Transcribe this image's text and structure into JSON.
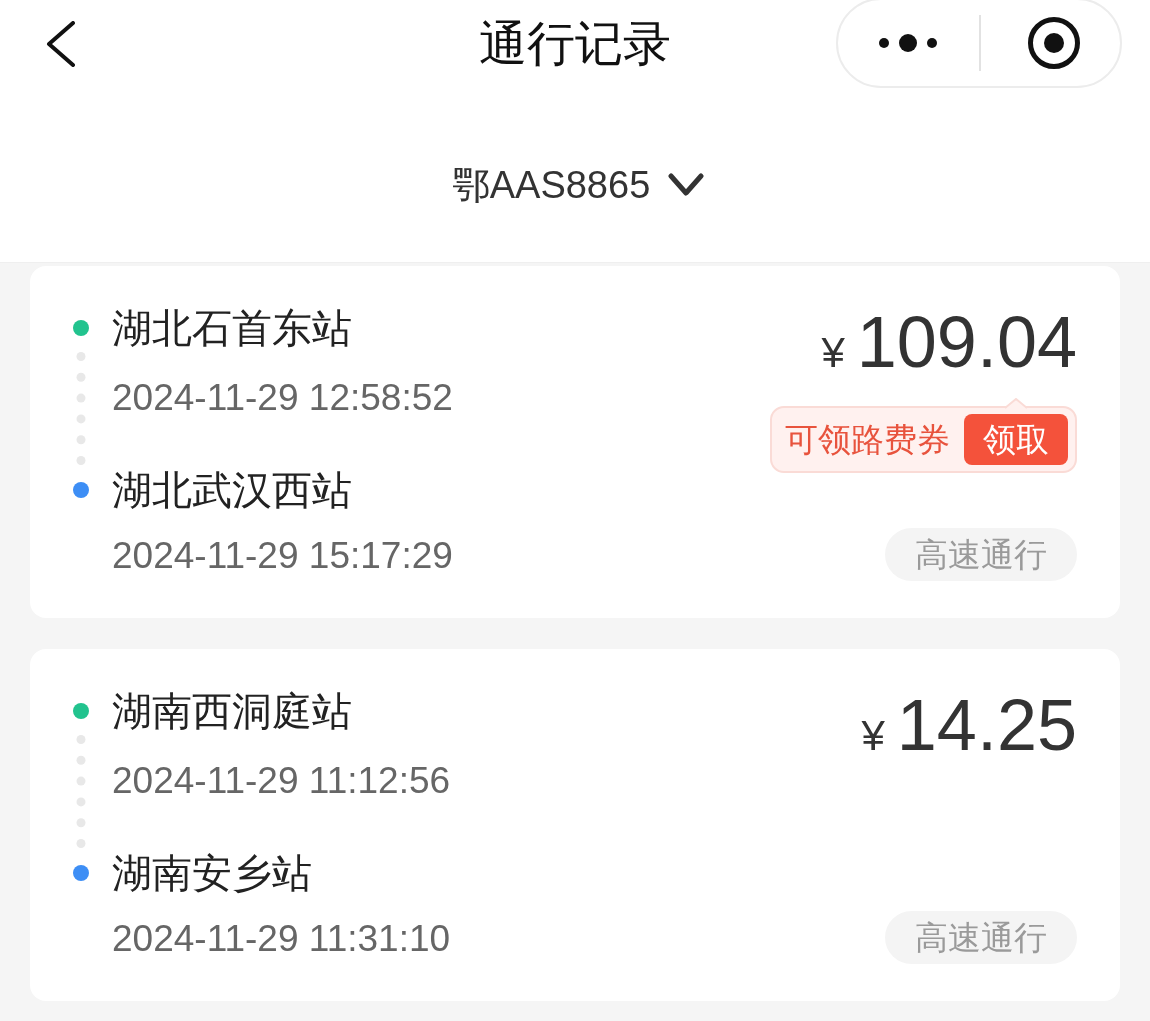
{
  "header": {
    "title": "通行记录"
  },
  "plate_selector": {
    "plate": "鄂AAS8865"
  },
  "records": [
    {
      "stops": [
        {
          "station": "湖北石首东站",
          "time": "2024-11-29 12:58:52",
          "color": "#22c38e"
        },
        {
          "station": "湖北武汉西站",
          "time": "2024-11-29 15:17:29",
          "color": "#3d8ef5"
        }
      ],
      "price": {
        "currency": "¥",
        "amount": "109.04"
      },
      "coupon": {
        "text": "可领路费券",
        "button": "领取"
      },
      "tag": "高速通行"
    },
    {
      "stops": [
        {
          "station": "湖南西洞庭站",
          "time": "2024-11-29 11:12:56",
          "color": "#22c38e"
        },
        {
          "station": "湖南安乡站",
          "time": "2024-11-29 11:31:10",
          "color": "#3d8ef5"
        }
      ],
      "price": {
        "currency": "¥",
        "amount": "14.25"
      },
      "tag": "高速通行"
    }
  ]
}
